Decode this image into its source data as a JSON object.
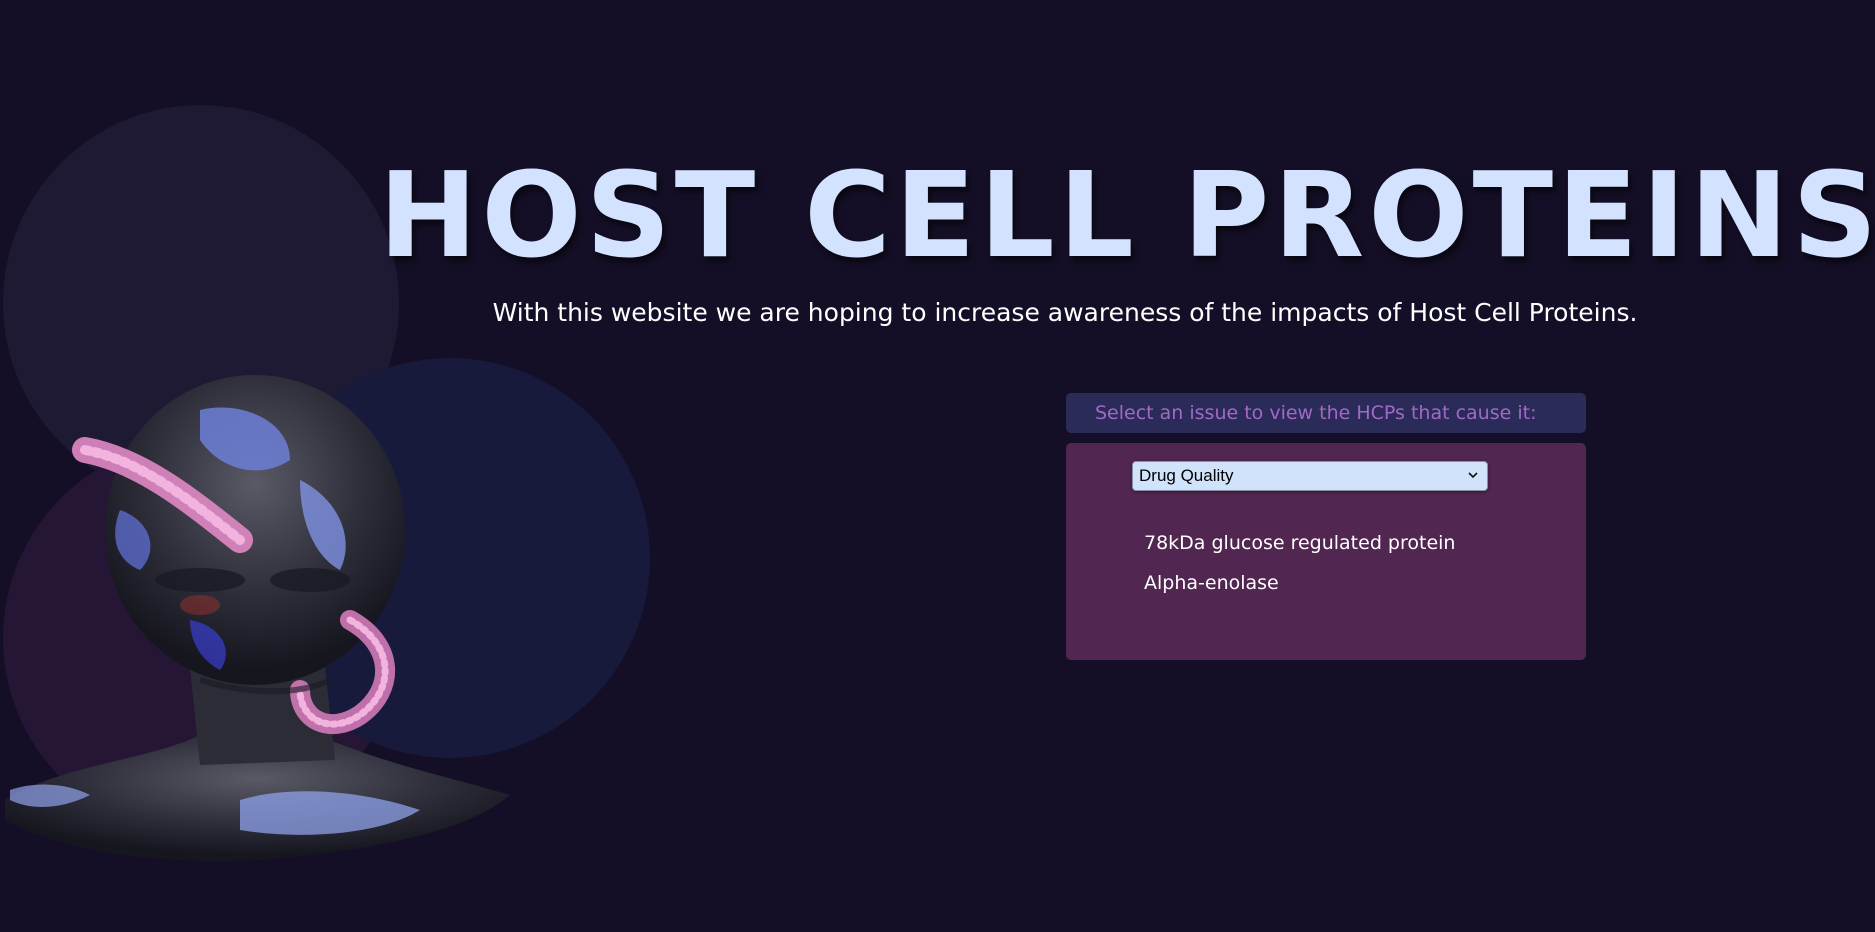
{
  "hero": {
    "title": "HOST CELL PROTEINS",
    "subtitle": "With this website we are hoping to increase awareness of the impacts of Host Cell Proteins."
  },
  "selector": {
    "prompt": "Select an issue to view the HCPs that cause it:",
    "selected_value": "Drug Quality"
  },
  "hcp_list": [
    "78kDa glucose regulated protein",
    "Alpha-enolase"
  ],
  "colors": {
    "background": "#140f26",
    "title": "#d3e3ff",
    "prompt_text": "#a169c6",
    "panel": "#512650",
    "select": "#d1e2fb"
  },
  "icons": {
    "select_arrow": "chevron-down-icon",
    "illustration": "protein-bust-illustration"
  }
}
